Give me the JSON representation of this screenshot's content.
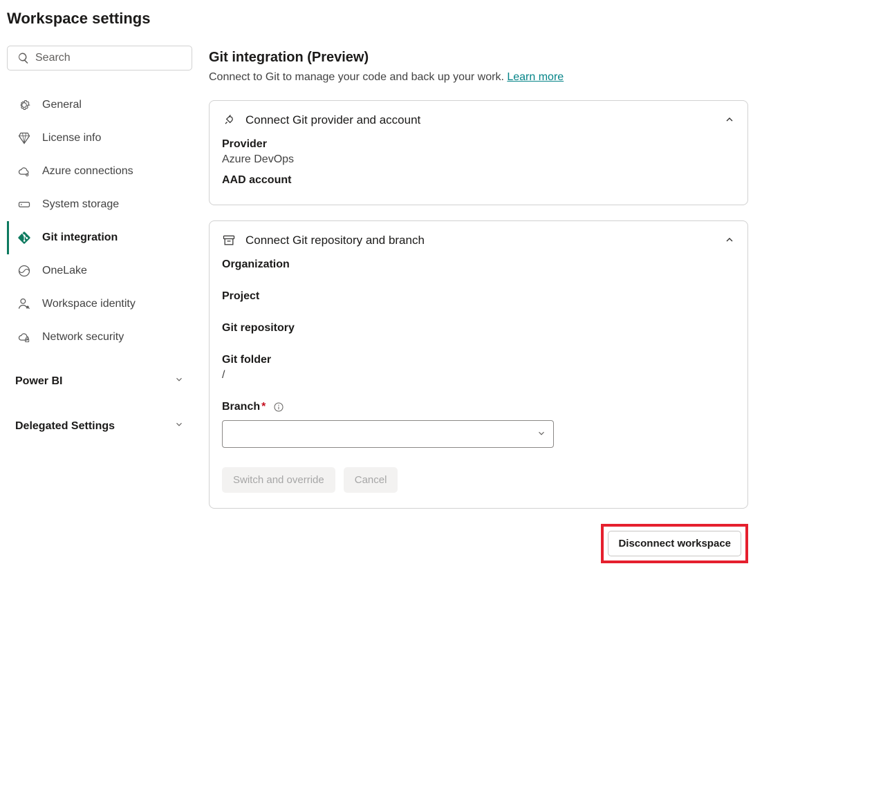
{
  "page_title": "Workspace settings",
  "search": {
    "placeholder": "Search"
  },
  "sidebar": {
    "items": [
      {
        "label": "General"
      },
      {
        "label": "License info"
      },
      {
        "label": "Azure connections"
      },
      {
        "label": "System storage"
      },
      {
        "label": "Git integration"
      },
      {
        "label": "OneLake"
      },
      {
        "label": "Workspace identity"
      },
      {
        "label": "Network security"
      }
    ],
    "sections": [
      {
        "label": "Power BI"
      },
      {
        "label": "Delegated Settings"
      }
    ]
  },
  "main": {
    "title": "Git integration (Preview)",
    "description": "Connect to Git to manage your code and back up your work. ",
    "learn_more": "Learn more",
    "card1": {
      "title": "Connect Git provider and account",
      "provider_label": "Provider",
      "provider_value": "Azure DevOps",
      "account_label": "AAD account"
    },
    "card2": {
      "title": "Connect Git repository and branch",
      "org_label": "Organization",
      "project_label": "Project",
      "repo_label": "Git repository",
      "folder_label": "Git folder",
      "folder_value": "/",
      "branch_label": "Branch",
      "switch_btn": "Switch and override",
      "cancel_btn": "Cancel"
    },
    "disconnect_btn": "Disconnect workspace"
  }
}
